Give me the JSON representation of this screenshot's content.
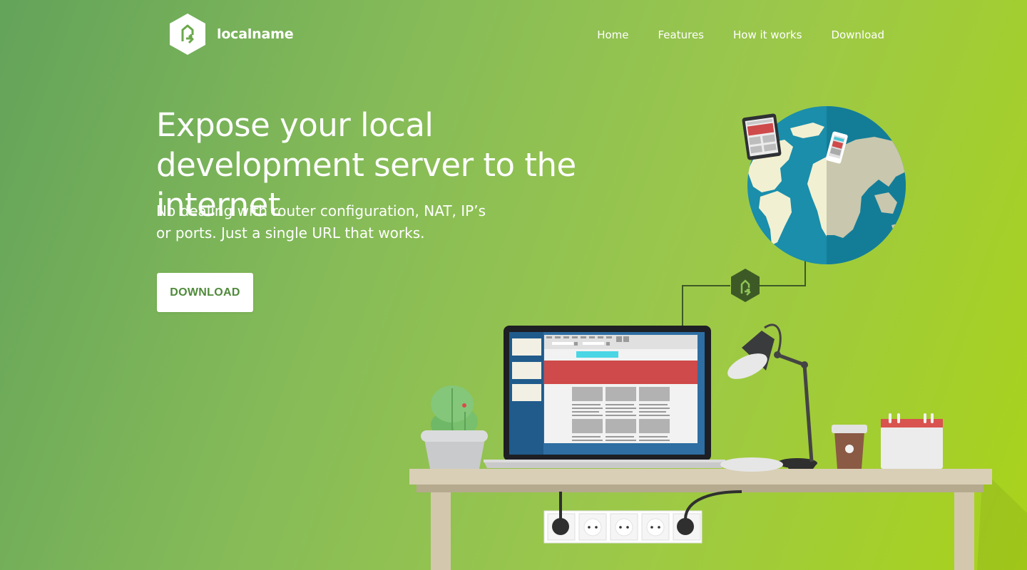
{
  "brand": {
    "name": "localname",
    "logo_icon": "hexagon-arrow-icon"
  },
  "nav": {
    "items": [
      "Home",
      "Features",
      "How it works",
      "Download"
    ]
  },
  "hero": {
    "title": "Expose your local development server to the internet",
    "subtitle": "No dealing with router configuration, NAT, IP’s or ports. Just a single URL that works.",
    "cta_label": "DOWNLOAD"
  },
  "colors": {
    "accent": "#4f8a3a",
    "background_start": "#63a35a",
    "background_end": "#a9d31a",
    "desk": "#d9cfb6",
    "ocean": "#1b8fae",
    "brand_green": "#3d5a26"
  }
}
